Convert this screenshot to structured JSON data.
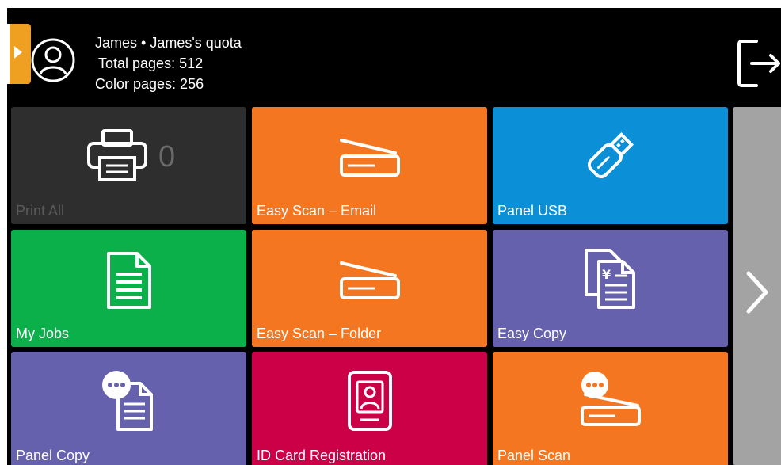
{
  "user": {
    "title": "James • James's quota",
    "total_pages": "Total pages: 512",
    "color_pages": "Color pages: 256"
  },
  "icons": {
    "avatar": "user-avatar-icon",
    "logout": "logout-icon",
    "side_tab": "expand-arrow-icon",
    "next": "chevron-right-icon"
  },
  "tiles": [
    {
      "label": "Print All",
      "color": "#2e2e2e",
      "icon": "printer-icon",
      "count": "0"
    },
    {
      "label": "Easy Scan – Email",
      "color": "#f47621",
      "icon": "scanner-icon"
    },
    {
      "label": "Panel USB",
      "color": "#0b8fd6",
      "icon": "usb-drive-icon"
    },
    {
      "label": "My Jobs",
      "color": "#0bb04b",
      "icon": "document-icon"
    },
    {
      "label": "Easy Scan – Folder",
      "color": "#f47621",
      "icon": "scanner-icon"
    },
    {
      "label": "Easy Copy",
      "color": "#6661ad",
      "icon": "copy-document-icon"
    },
    {
      "label": "Panel Copy",
      "color": "#6661ad",
      "icon": "panel-copy-icon"
    },
    {
      "label": "ID Card Registration",
      "color": "#cc0047",
      "icon": "id-card-icon"
    },
    {
      "label": "Panel Scan",
      "color": "#f47621",
      "icon": "panel-scan-icon"
    }
  ],
  "colors": {
    "background": "#000000",
    "accent": "#f0a020",
    "next_panel": "#a3a3a3"
  }
}
